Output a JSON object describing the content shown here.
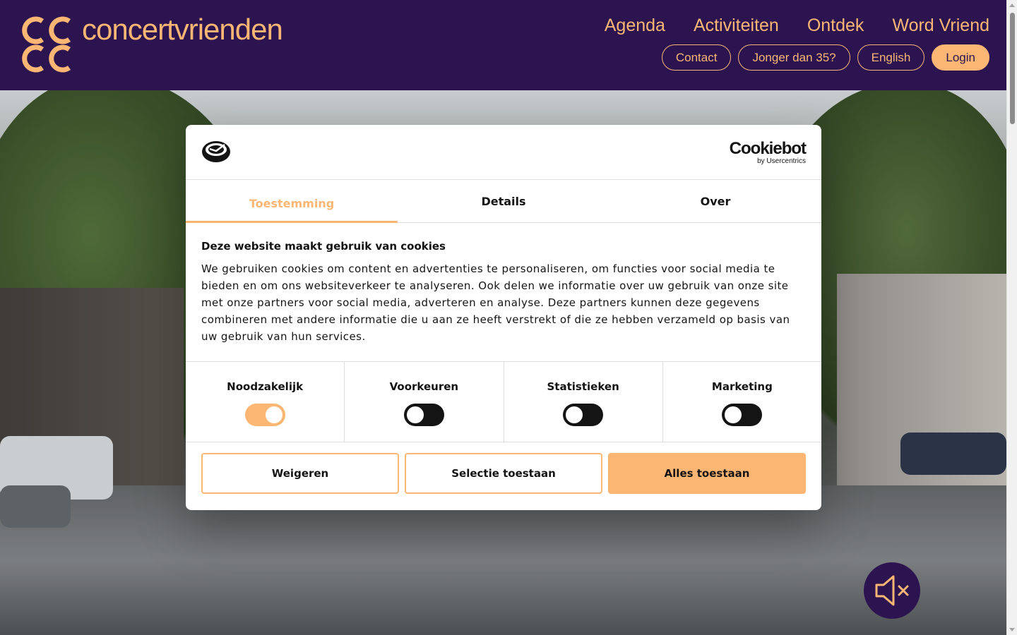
{
  "brand": {
    "name": "concertvrienden",
    "accent": "#fbb674",
    "header_bg": "#2b1450"
  },
  "main_nav": [
    "Agenda",
    "Activiteiten",
    "Ontdek",
    "Word Vriend"
  ],
  "sub_nav": {
    "contact": "Contact",
    "young": "Jonger dan 35?",
    "english": "English",
    "login": "Login"
  },
  "cookie": {
    "provider": "Cookiebot",
    "provider_sub": "by Usercentrics",
    "tabs": [
      "Toestemming",
      "Details",
      "Over"
    ],
    "active_tab": "Toestemming",
    "title": "Deze website maakt gebruik van cookies",
    "text": "We gebruiken cookies om content en advertenties te personaliseren, om functies voor social media te bieden en om ons websiteverkeer te analyseren. Ook delen we informatie over uw gebruik van onze site met onze partners voor social media, adverteren en analyse. Deze partners kunnen deze gegevens combineren met andere informatie die u aan ze heeft verstrekt of die ze hebben verzameld op basis van uw gebruik van hun services.",
    "categories": [
      {
        "label": "Noodzakelijk",
        "on": true
      },
      {
        "label": "Voorkeuren",
        "on": false
      },
      {
        "label": "Statistieken",
        "on": false
      },
      {
        "label": "Marketing",
        "on": false
      }
    ],
    "buttons": {
      "decline": "Weigeren",
      "selection": "Selectie toestaan",
      "allow_all": "Alles toestaan"
    }
  },
  "icons": {
    "mute": "speaker-muted-icon"
  }
}
